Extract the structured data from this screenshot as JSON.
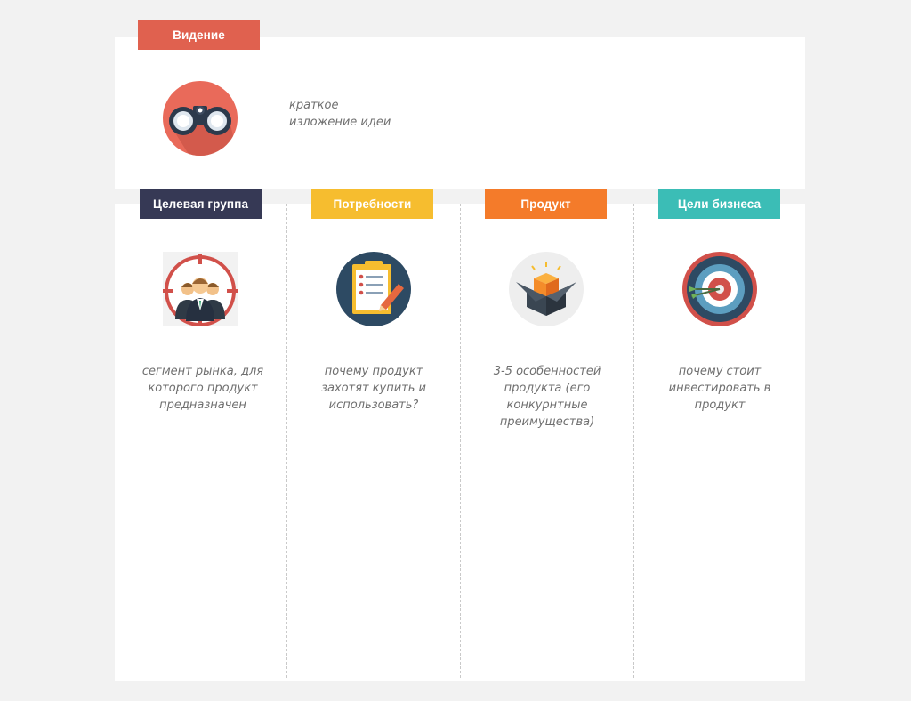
{
  "vision": {
    "label": "Видение",
    "color": "#e0614f",
    "icon": "binoculars-icon",
    "desc_line1": "краткое",
    "desc_line2": "изложение идеи"
  },
  "columns": [
    {
      "label": "Целевая группа",
      "color": "#363955",
      "icon": "target-audience-icon",
      "desc": "сегмент рынка, для которого продукт предназначен"
    },
    {
      "label": "Потребности",
      "color": "#f6bd2f",
      "icon": "clipboard-checklist-icon",
      "desc": "почему продукт захотят купить и использовать?"
    },
    {
      "label": "Продукт",
      "color": "#f47b2a",
      "icon": "product-box-icon",
      "desc": "3-5 особенностей продукта (его конкурнтные преимущества)"
    },
    {
      "label": "Цели бизнеса",
      "color": "#3bbdb6",
      "icon": "bullseye-target-icon",
      "desc": "почему стоит инвестировать в продукт"
    }
  ]
}
